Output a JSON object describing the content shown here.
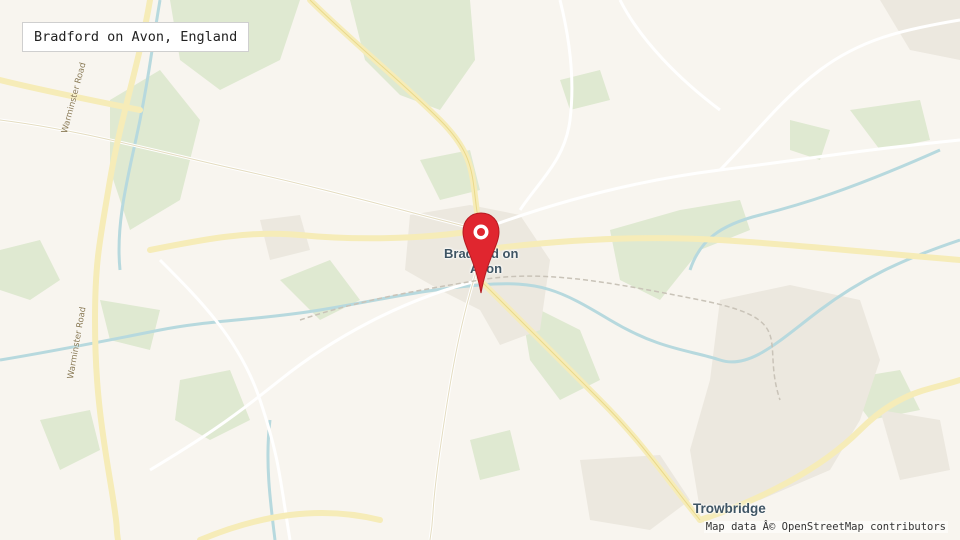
{
  "location": {
    "label": "Bradford on Avon, England"
  },
  "attribution": "Map data Â© OpenStreetMap contributors",
  "places": {
    "town1_line1": "Bradford on",
    "town1_line2": "Avon",
    "town2": "Trowbridge"
  },
  "roads": {
    "road1": "Warminster Road",
    "road2": "Warminster Road"
  },
  "icons": {
    "marker": "map-pin-icon"
  },
  "colors": {
    "land": "#f8f5ef",
    "green": "#dde8cf",
    "road": "#f6ecb8",
    "river": "#b7d9de",
    "marker": "#e0262f"
  }
}
